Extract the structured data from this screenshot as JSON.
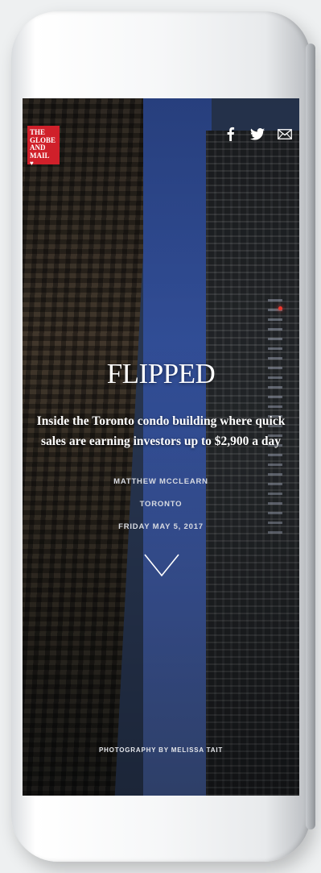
{
  "brand": {
    "logo_line1": "THE",
    "logo_line2": "GLOBE",
    "logo_line3": "AND",
    "logo_line4": "MAIL",
    "logo_color": "#d0202a"
  },
  "social": {
    "icons": [
      "facebook-icon",
      "twitter-icon",
      "email-icon"
    ]
  },
  "article": {
    "title": "FLIPPED",
    "dek": "Inside the Toronto condo building where quick sales are earning investors up to $2,900 a day",
    "author": "MATTHEW MCCLEARN",
    "location": "TORONTO",
    "date": "FRIDAY MAY 5, 2017",
    "photo_credit": "PHOTOGRAPHY BY MELISSA TAIT"
  },
  "colors": {
    "sky": "#3553a0",
    "text": "#ffffff"
  }
}
